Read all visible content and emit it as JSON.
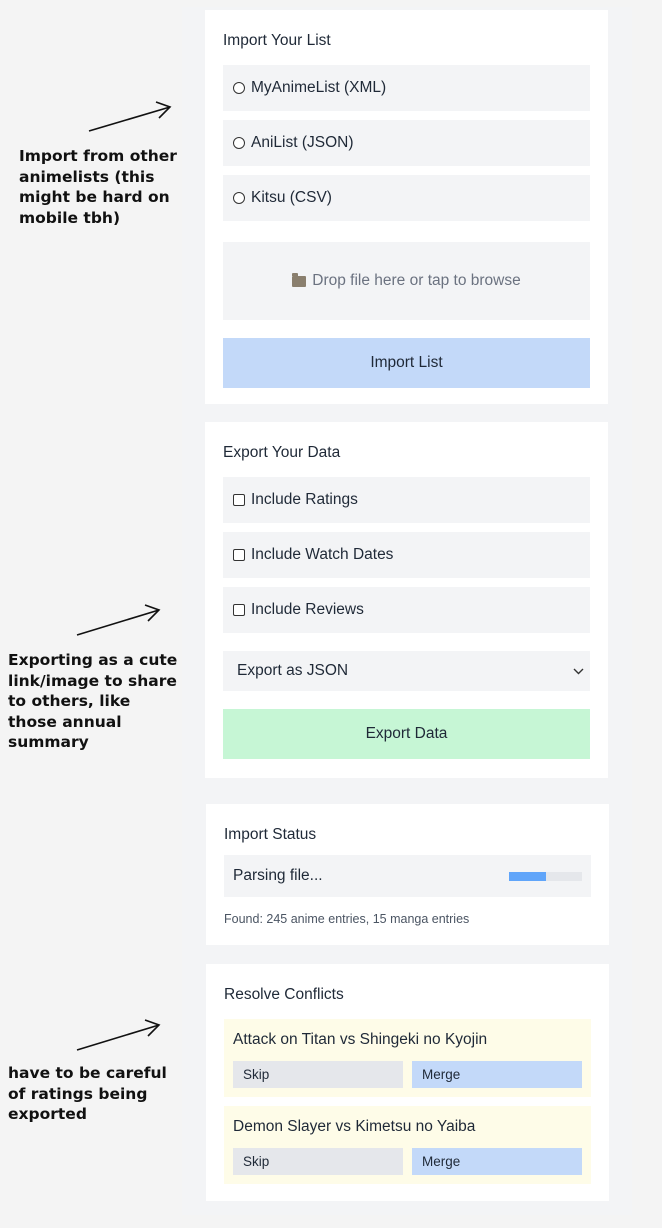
{
  "annotations": {
    "import_note": "Import from other animelists (this might be hard on mobile tbh)",
    "export_note": "Exporting as a cute link/image to share to others, like those annual summary",
    "ratings_note": "have to be careful of ratings being exported"
  },
  "import_section": {
    "title": "Import Your List",
    "options": [
      {
        "label": "MyAnimeList (XML)"
      },
      {
        "label": "AniList (JSON)"
      },
      {
        "label": "Kitsu (CSV)"
      }
    ],
    "dropzone_text": "Drop file here or tap to browse",
    "button_label": "Import List"
  },
  "export_section": {
    "title": "Export Your Data",
    "checkboxes": [
      {
        "label": "Include Ratings",
        "checked": false
      },
      {
        "label": "Include Watch Dates",
        "checked": false
      },
      {
        "label": "Include Reviews",
        "checked": false
      }
    ],
    "format_selected": "Export as JSON",
    "button_label": "Export Data"
  },
  "status_section": {
    "title": "Import Status",
    "status_text": "Parsing file...",
    "progress": 0.5,
    "found_text": "Found: 245 anime entries, 15 manga entries"
  },
  "conflicts_section": {
    "title": "Resolve Conflicts",
    "items": [
      {
        "title": "Attack on Titan vs Shingeki no Kyojin",
        "skip_label": "Skip",
        "merge_label": "Merge"
      },
      {
        "title": "Demon Slayer vs Kimetsu no Yaiba",
        "skip_label": "Skip",
        "merge_label": "Merge"
      }
    ]
  },
  "colors": {
    "import_button": "#c3d9f9",
    "export_button": "#c6f6d5",
    "progress_fill": "#60a5fa",
    "conflict_bg": "#fefce8"
  }
}
